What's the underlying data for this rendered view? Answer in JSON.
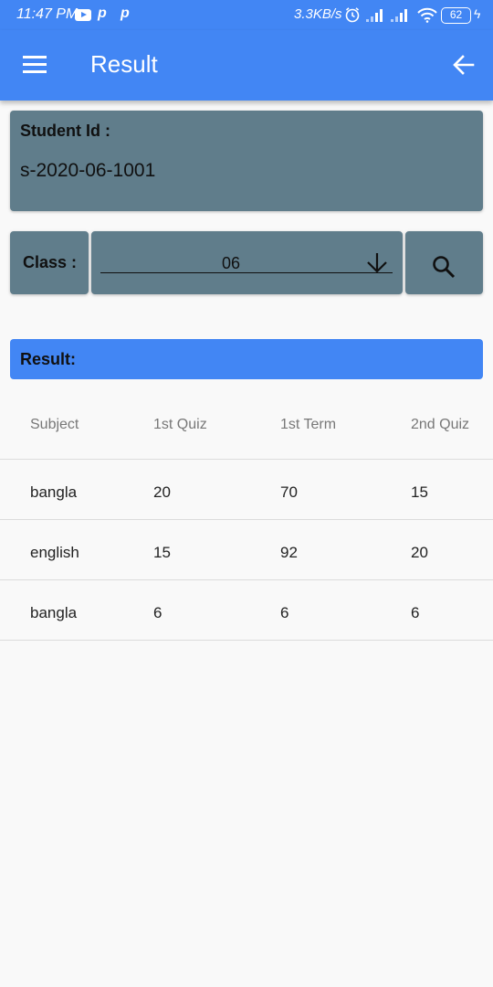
{
  "status_bar": {
    "time": "11:47 PM",
    "app_icons": [
      "youtube-icon",
      "p",
      "p"
    ],
    "net_speed": "3.3KB/s",
    "battery": "62"
  },
  "app_bar": {
    "title": "Result",
    "menu_icon": "hamburger-menu-icon",
    "back_icon": "arrow-back-icon"
  },
  "student": {
    "label": "Student Id :",
    "value": "s-2020-06-1001"
  },
  "class_filter": {
    "label": "Class :",
    "selected": "06",
    "search_icon": "search-icon"
  },
  "result": {
    "label": "Result:",
    "columns": [
      "Subject",
      "1st Quiz",
      "1st Term",
      "2nd Quiz"
    ],
    "rows": [
      [
        "bangla",
        "20",
        "70",
        "15"
      ],
      [
        "english",
        "15",
        "92",
        "20"
      ],
      [
        "bangla",
        "6",
        "6",
        "6"
      ]
    ]
  },
  "colors": {
    "primary": "#4286f4",
    "card": "#607d8b",
    "background": "#f9f9f9"
  }
}
